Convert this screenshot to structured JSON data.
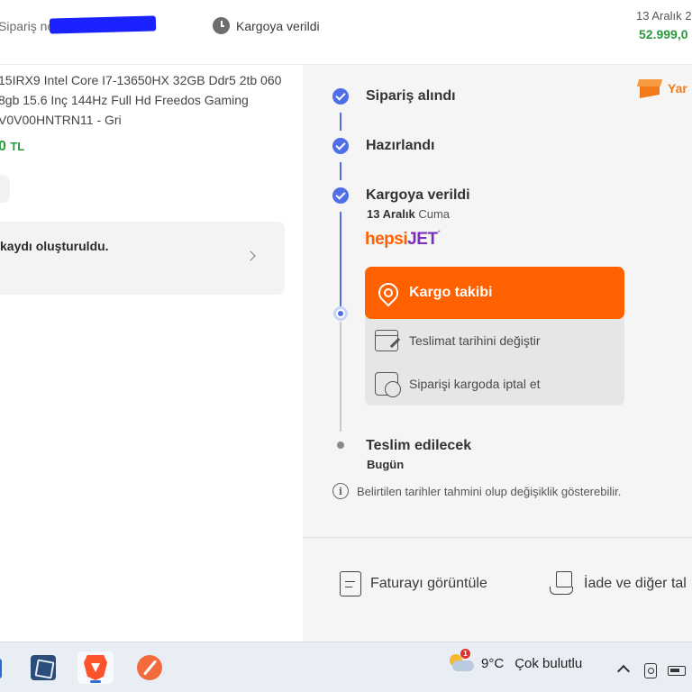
{
  "header": {
    "order_no_label": "Sipariş no:",
    "status": "Kargoya verildi",
    "date": "13 Aralık 2",
    "price": "52.999,0"
  },
  "product": {
    "title": "15IRX9 Intel Core I7-13650HX 32GB Ddr5 2tb 060 8gb 15.6 Inç 144Hz Full Hd Freedos Gaming V0V00HNTRN11 - Gri",
    "price": "0",
    "currency": "TL"
  },
  "record_card": {
    "text": "kaydı oluşturuldu."
  },
  "returns_tag": {
    "label": "Yar",
    "icon": "box-icon"
  },
  "steps": [
    {
      "title": "Sipariş alındı",
      "state": "done"
    },
    {
      "title": "Hazırlandı",
      "state": "done"
    },
    {
      "title": "Kargoya verildi",
      "state": "done",
      "date_bold": "13 Aralık",
      "date_rest": " Cuma"
    },
    {
      "title": "Teslim edilecek",
      "state": "pending",
      "sub": "Bugün"
    }
  ],
  "carrier": {
    "part1": "hepsi",
    "part2": "JET",
    "tick": "´"
  },
  "actions": {
    "track": "Kargo takibi",
    "change_date": "Teslimat tarihini değiştir",
    "cancel": "Siparişi kargoda iptal et"
  },
  "info": "Belirtilen tarihler tahmini olup değişiklik gösterebilir.",
  "bottom_links": {
    "invoice": "Faturayı görüntüle",
    "returns": "İade ve diğer tal"
  },
  "taskbar": {
    "weather_badge": "1",
    "temperature": "9°C",
    "condition": "Çok bulutlu"
  },
  "colors": {
    "accent": "#ff6000",
    "step_blue": "#4f6ee8",
    "price_green": "#2b9a3e",
    "redaction_blue": "#1a22ff"
  }
}
